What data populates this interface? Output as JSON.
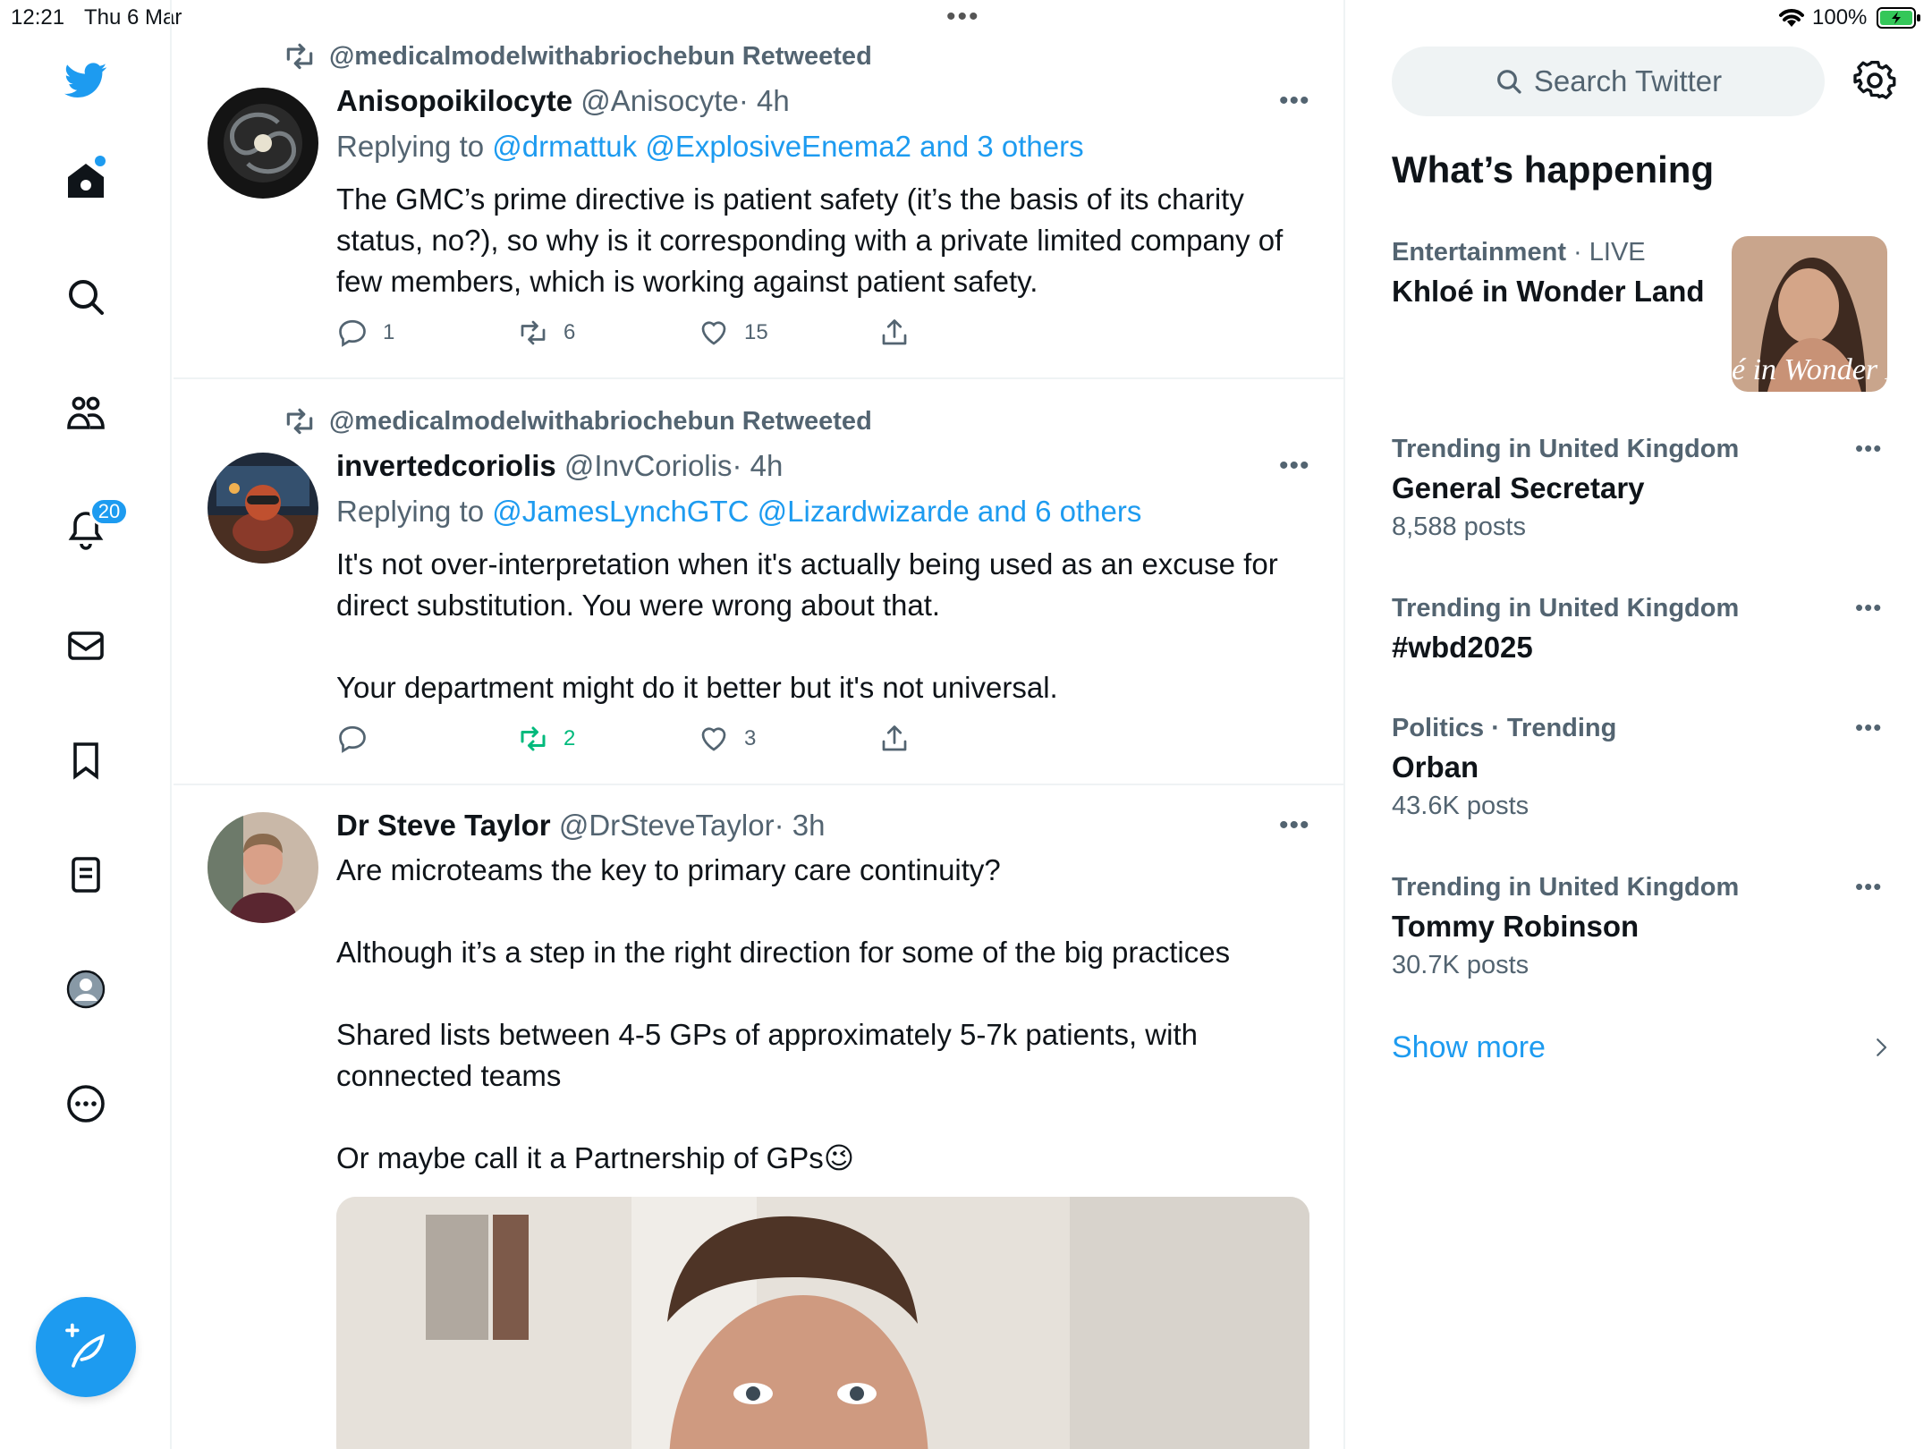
{
  "status_bar": {
    "time": "12:21",
    "date": "Thu 6 Mar",
    "battery": "100%"
  },
  "nav": {
    "items": [
      {
        "name": "home",
        "icon": "home-icon"
      },
      {
        "name": "explore",
        "icon": "search-icon"
      },
      {
        "name": "communities",
        "icon": "communities-icon"
      },
      {
        "name": "notifications",
        "icon": "bell-icon"
      },
      {
        "name": "messages",
        "icon": "mail-icon"
      },
      {
        "name": "bookmarks",
        "icon": "bookmark-icon"
      },
      {
        "name": "lists",
        "icon": "list-icon"
      },
      {
        "name": "profile",
        "icon": "profile-icon"
      },
      {
        "name": "more",
        "icon": "more-circle-icon"
      }
    ],
    "notifications_badge": "20",
    "compose_icon": "compose-icon"
  },
  "feed": {
    "tweets": [
      {
        "retweeted_by": "@medicalmodelwithabriochebun Retweeted",
        "name": "Anisopoikilocyte",
        "handle": "@Anisocyte",
        "time": "· 4h",
        "replying_prefix": "Replying to",
        "replying_to": "@drmattuk @ExplosiveEnema2 and 3 others",
        "text": [
          "The GMC’s prime directive is patient safety (it’s the basis of its charity status, no?), so why is it corresponding with a private limited company of few members, which is working against patient safety."
        ],
        "replies": "1",
        "retweets": "6",
        "likes": "15"
      },
      {
        "retweeted_by": "@medicalmodelwithabriochebun Retweeted",
        "name": "invertedcoriolis",
        "handle": "@InvCoriolis",
        "time": "· 4h",
        "replying_prefix": "Replying to",
        "replying_to": "@JamesLynchGTC @Lizardwizarde and 6 others",
        "text": [
          "It's not over-interpretation when it's actually being used as an excuse for direct substitution. You were wrong about that.",
          "Your department might do it better but it's not universal."
        ],
        "replies": "",
        "retweets": "2",
        "likes": "3"
      },
      {
        "name": "Dr Steve Taylor",
        "handle": "@DrSteveTaylor",
        "time": "· 3h",
        "text": [
          "Are microteams the key to primary care continuity?",
          "Although it’s a step in the right direction for some of the big practices",
          "Shared lists between 4-5 GPs of approximately 5-7k patients, with connected teams",
          "Or maybe call it a Partnership of GPs😉"
        ]
      }
    ]
  },
  "sidebar": {
    "search_placeholder": "Search Twitter",
    "section_title": "What’s happening",
    "trends": [
      {
        "category": "Entertainment",
        "category_extra": "· LIVE",
        "title": "Khloé in Wonder Land",
        "count": ""
      },
      {
        "category": "Trending in United Kingdom",
        "category_extra": "",
        "title": "General Secretary",
        "count": "8,588 posts"
      },
      {
        "category": "Trending in United Kingdom",
        "category_extra": "",
        "title": "#wbd2025",
        "count": ""
      },
      {
        "category": "Politics · Trending",
        "category_extra": "",
        "title": "Orban",
        "count": "43.6K posts"
      },
      {
        "category": "Trending in United Kingdom",
        "category_extra": "",
        "title": "Tommy Robinson",
        "count": "30.7K posts"
      }
    ],
    "trend_image_text": "é in Wonder L",
    "show_more": "Show more"
  },
  "colors": {
    "accent": "#1d9bf0",
    "secondary_text": "#536471",
    "retweet_green": "#00ba7c",
    "divider": "#eff3f4"
  }
}
